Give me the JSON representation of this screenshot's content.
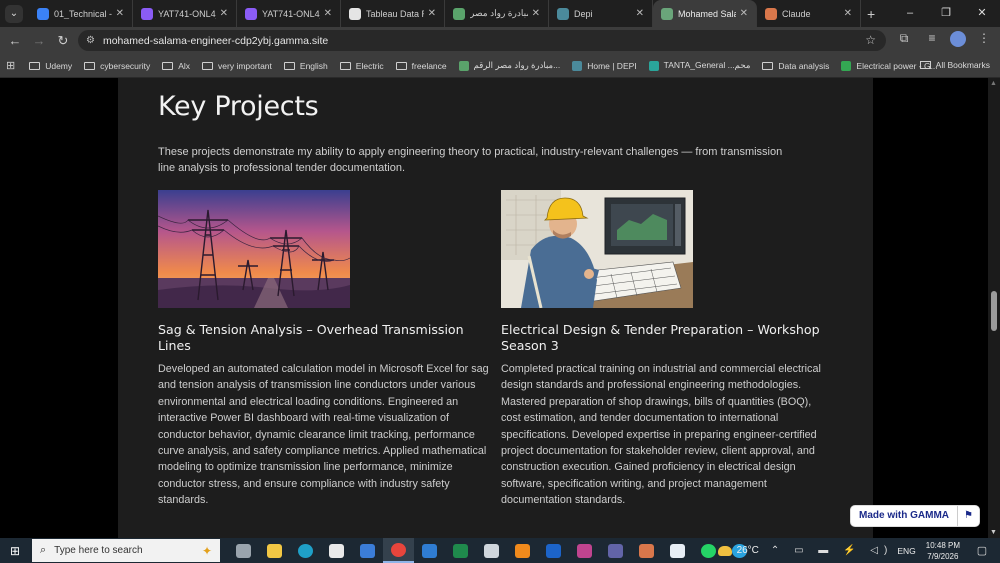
{
  "browser": {
    "tabs": [
      {
        "label": "01_Technical - Gi",
        "color": "#3b82f6"
      },
      {
        "label": "YAT741-ONL4_D",
        "color": "#8b5cf6"
      },
      {
        "label": "YAT741-ONL4_D",
        "color": "#8b5cf6"
      },
      {
        "label": "Tableau Data Re",
        "color": "#e5e5e5"
      },
      {
        "label": "مبادرة رواد مصر",
        "color": "#5aa36b"
      },
      {
        "label": "Depi",
        "color": "#4b8a9b"
      },
      {
        "label": "Mohamed Salam",
        "color": "#6aa57a"
      },
      {
        "label": "Claude",
        "color": "#d9774b"
      }
    ],
    "active_tab_index": 6,
    "new_tab_glyph": "+",
    "window_controls": [
      "–",
      "❐",
      "✕"
    ],
    "url": "mohamed-salama-engineer-cdp2ybj.gamma.site",
    "bookmarks": [
      {
        "label": "Udemy",
        "icon": "folder-icon"
      },
      {
        "label": "cybersecurity",
        "icon": "folder-icon"
      },
      {
        "label": "Alx",
        "icon": "folder-icon"
      },
      {
        "label": "very important",
        "icon": "folder-icon"
      },
      {
        "label": "English",
        "icon": "folder-icon"
      },
      {
        "label": "Electric",
        "icon": "folder-icon"
      },
      {
        "label": "freelance",
        "icon": "folder-icon"
      },
      {
        "label": "مبادرة رواد مصر الرقم...",
        "icon": "site-icon",
        "color": "#5aa36b"
      },
      {
        "label": "Home | DEPI",
        "icon": "site-icon",
        "color": "#4b8a9b"
      },
      {
        "label": "TANTA_General ...محم",
        "icon": "site-icon",
        "color": "#2aa59a"
      },
      {
        "label": "Data analysis",
        "icon": "folder-icon"
      },
      {
        "label": "Electrical power - G...",
        "icon": "site-icon",
        "color": "#34a853"
      }
    ],
    "all_bookmarks_label": "All Bookmarks"
  },
  "page": {
    "heading": "Key Projects",
    "intro": "These projects demonstrate my ability to apply engineering theory to practical, industry-relevant challenges — from transmission line analysis to professional tender documentation.",
    "projects": [
      {
        "title": "Sag & Tension Analysis – Overhead Transmission Lines",
        "description": "Developed an automated calculation model in Microsoft Excel for sag and tension analysis of transmission line conductors under various environmental and electrical loading conditions. Engineered an interactive Power BI dashboard with real-time visualization of conductor behavior, dynamic clearance limit tracking, performance curve analysis, and safety compliance metrics. Applied mathematical modeling to optimize transmission line performance, minimize conductor stress, and ensure compliance with industry safety standards."
      },
      {
        "title": "Electrical Design & Tender Preparation – Workshop Season 3",
        "description": "Completed practical training on industrial and commercial electrical design standards and professional engineering methodologies. Mastered preparation of shop drawings, bills of quantities (BOQ), cost estimation, and tender documentation to international specifications. Developed expertise in preparing engineer-certified project documentation for stakeholder review, client approval, and construction execution. Gained proficiency in electrical design software, specification writing, and project management documentation standards."
      }
    ],
    "badge_label": "Made with GAMMA"
  },
  "taskbar": {
    "search_placeholder": "Type here to search",
    "weather": "26°C",
    "language": "ENG",
    "time": "10:48 PM",
    "date": "7/9/2026",
    "apps": [
      {
        "name": "task-view",
        "color": "#9aa4ad"
      },
      {
        "name": "file-explorer",
        "color": "#f2c744"
      },
      {
        "name": "edge",
        "color": "#1fa0c8"
      },
      {
        "name": "store",
        "color": "#e9e9e9"
      },
      {
        "name": "photos",
        "color": "#3b7dd8"
      },
      {
        "name": "chrome",
        "color": "#e8453c"
      },
      {
        "name": "mail",
        "color": "#2f7dd3"
      },
      {
        "name": "excel",
        "color": "#1f8a4c"
      },
      {
        "name": "keyboard",
        "color": "#cfd6dc"
      },
      {
        "name": "vlc",
        "color": "#f08a1c"
      },
      {
        "name": "outlook",
        "color": "#1c64c9"
      },
      {
        "name": "copilot",
        "color": "#c0448f"
      },
      {
        "name": "teams",
        "color": "#6264a7"
      },
      {
        "name": "claude",
        "color": "#d9774b"
      },
      {
        "name": "snipping",
        "color": "#e7eef5"
      },
      {
        "name": "whatsapp",
        "color": "#25d366"
      },
      {
        "name": "telegram",
        "color": "#2aa3df"
      }
    ]
  }
}
